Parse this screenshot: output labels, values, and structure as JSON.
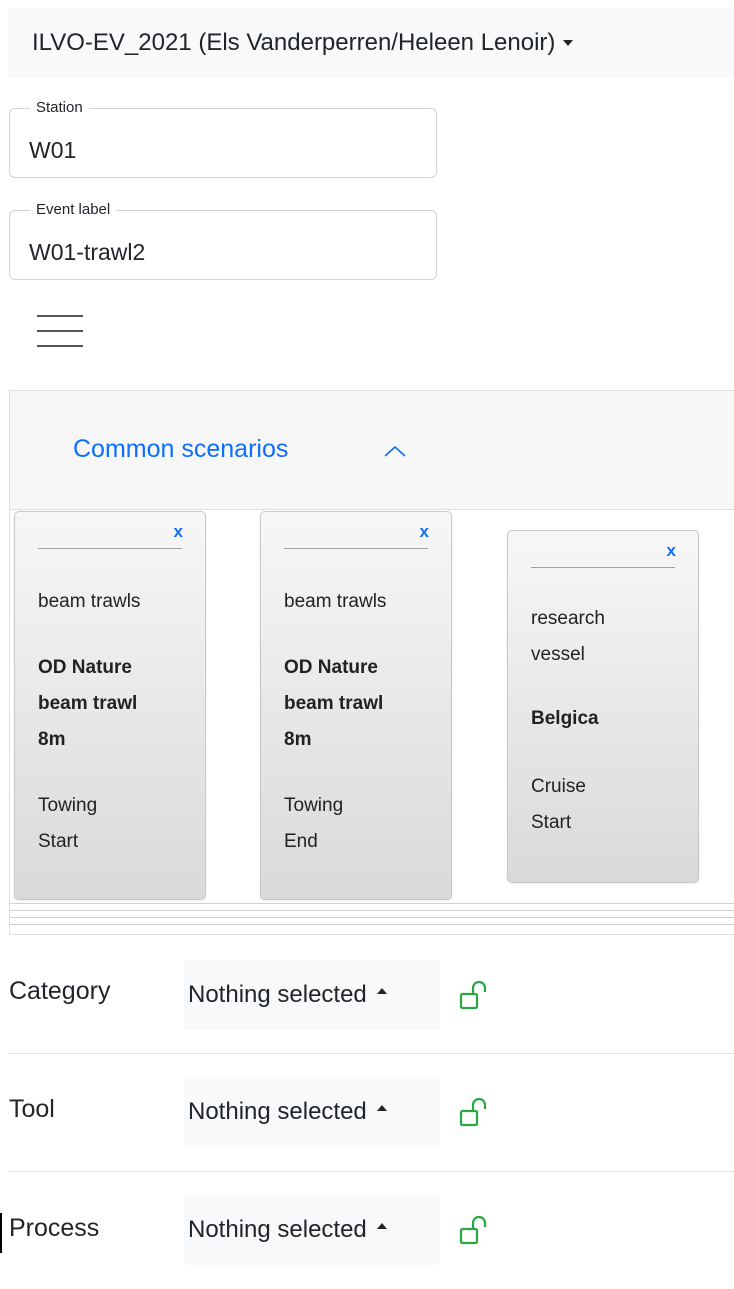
{
  "cruise": {
    "label": "ILVO-EV_2021 (Els Vanderperren/Heleen Lenoir)"
  },
  "station": {
    "label": "Station",
    "value": "W01"
  },
  "event_label": {
    "label": "Event label",
    "value": "W01-trawl2"
  },
  "common_scenarios": {
    "title": "Common scenarios",
    "cards": [
      {
        "close": "x",
        "category": "beam trawls",
        "tool_lines": [
          "OD Nature",
          "beam trawl",
          "8m"
        ],
        "process_lines": [
          "Towing",
          "Start"
        ]
      },
      {
        "close": "x",
        "category": "beam trawls",
        "tool_lines": [
          "OD Nature",
          "beam trawl",
          "8m"
        ],
        "process_lines": [
          "Towing",
          "End"
        ]
      },
      {
        "close": "x",
        "category_lines": [
          "research",
          "vessel"
        ],
        "tool": "Belgica",
        "process_lines": [
          "Cruise",
          "Start"
        ]
      }
    ]
  },
  "fields": [
    {
      "label": "Category",
      "value": "Nothing selected"
    },
    {
      "label": "Tool",
      "value": "Nothing selected"
    },
    {
      "label": "Process",
      "value": "Nothing selected"
    }
  ],
  "colors": {
    "link": "#0d6efd",
    "lock": "#28a745",
    "select_bg": "#f8f9fa"
  },
  "icons": {
    "menu": "hamburger-icon",
    "chevron": "chevron-up-icon",
    "lock": "unlock-icon",
    "caret": "caret-icon"
  }
}
